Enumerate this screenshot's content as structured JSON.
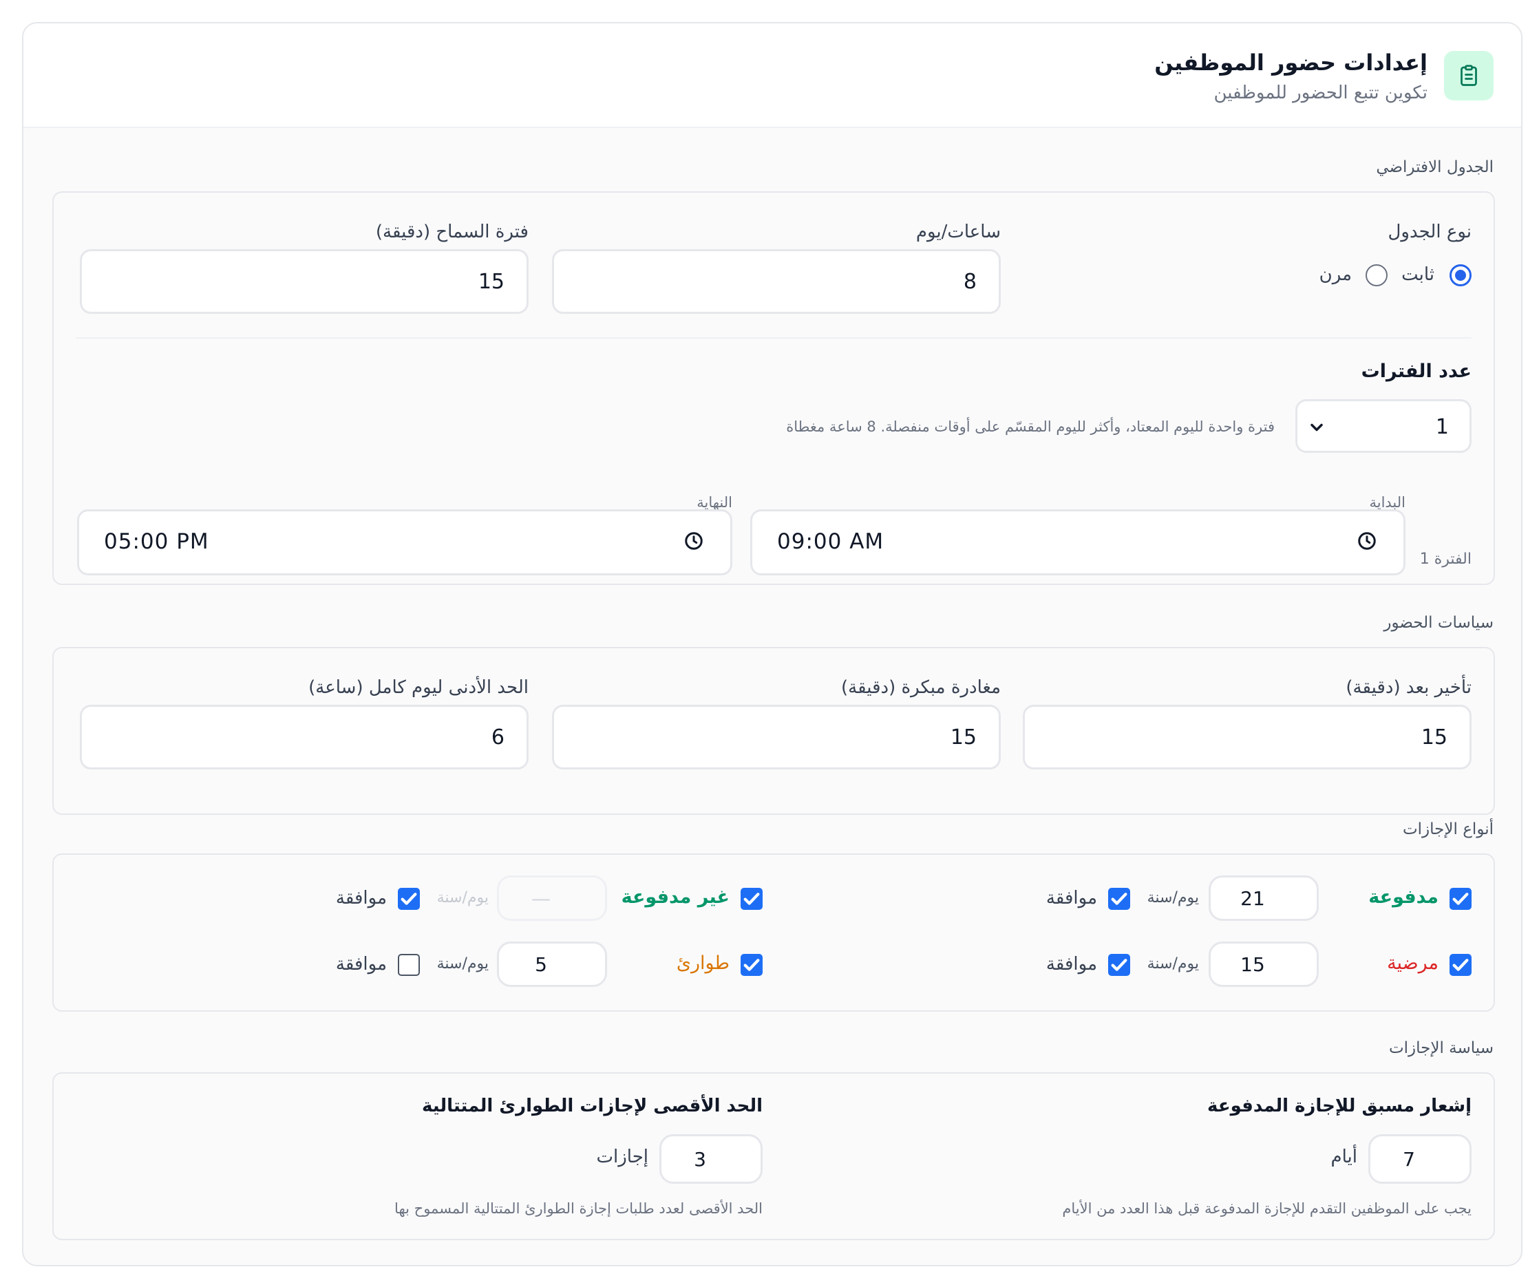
{
  "header": {
    "icon": "clipboard-list-icon",
    "title": "إعدادات حضور الموظفين",
    "subtitle": "تكوين تتبع الحضور للموظفين"
  },
  "default_schedule": {
    "section_title": "الجدول الافتراضي",
    "schedule_type_label": "نوع الجدول",
    "options": {
      "fixed": "ثابت",
      "flexible": "مرن"
    },
    "selected": "fixed",
    "hours_per_day_label": "ساعات/يوم",
    "hours_per_day": "8",
    "grace_period_label": "فترة السماح (دقيقة)",
    "grace_period": "15",
    "shifts_count_label": "عدد الفترات",
    "shifts_count": "1",
    "shifts_hint": "فترة واحدة لليوم المعتاد، وأكثر لليوم المقسّم على أوقات منفصلة. 8 ساعة مغطاة",
    "shift_label": "الفترة 1",
    "start_label": "البداية",
    "start_time": "09:00 AM",
    "end_label": "النهاية",
    "end_time": "05:00 PM"
  },
  "attendance_policies": {
    "section_title": "سياسات الحضور",
    "late_after_label": "تأخير بعد (دقيقة)",
    "late_after": "15",
    "early_leave_label": "مغادرة مبكرة (دقيقة)",
    "early_leave": "15",
    "min_full_day_label": "الحد الأدنى ليوم كامل (ساعة)",
    "min_full_day": "6"
  },
  "leave_types": {
    "section_title": "أنواع الإجازات",
    "unit": "يوم/سنة",
    "approval_label": "موافقة",
    "types": [
      {
        "name": "مدفوعة",
        "color": "#059669",
        "enabled": true,
        "days": "21",
        "approval": true
      },
      {
        "name": "غير مدفوعة",
        "color": "#059669",
        "enabled": true,
        "days": "—",
        "approval": true
      },
      {
        "name": "مرضية",
        "color": "#dc2626",
        "enabled": true,
        "days": "15",
        "approval": true
      },
      {
        "name": "طوارئ",
        "color": "#d97706",
        "enabled": true,
        "days": "5",
        "approval": false
      }
    ]
  },
  "leave_policy": {
    "section_title": "سياسة الإجازات",
    "advance_notice_label": "إشعار مسبق للإجازة المدفوعة",
    "advance_notice": "7",
    "advance_notice_unit": "أيام",
    "advance_notice_hint": "يجب على الموظفين التقدم للإجازة المدفوعة قبل هذا العدد من الأيام",
    "max_emergency_label": "الحد الأقصى لإجازات الطوارئ المتتالية",
    "max_emergency": "3",
    "max_emergency_unit": "إجازات",
    "max_emergency_hint": "الحد الأقصى لعدد طلبات إجازة الطوارئ المتتالية المسموح بها"
  }
}
